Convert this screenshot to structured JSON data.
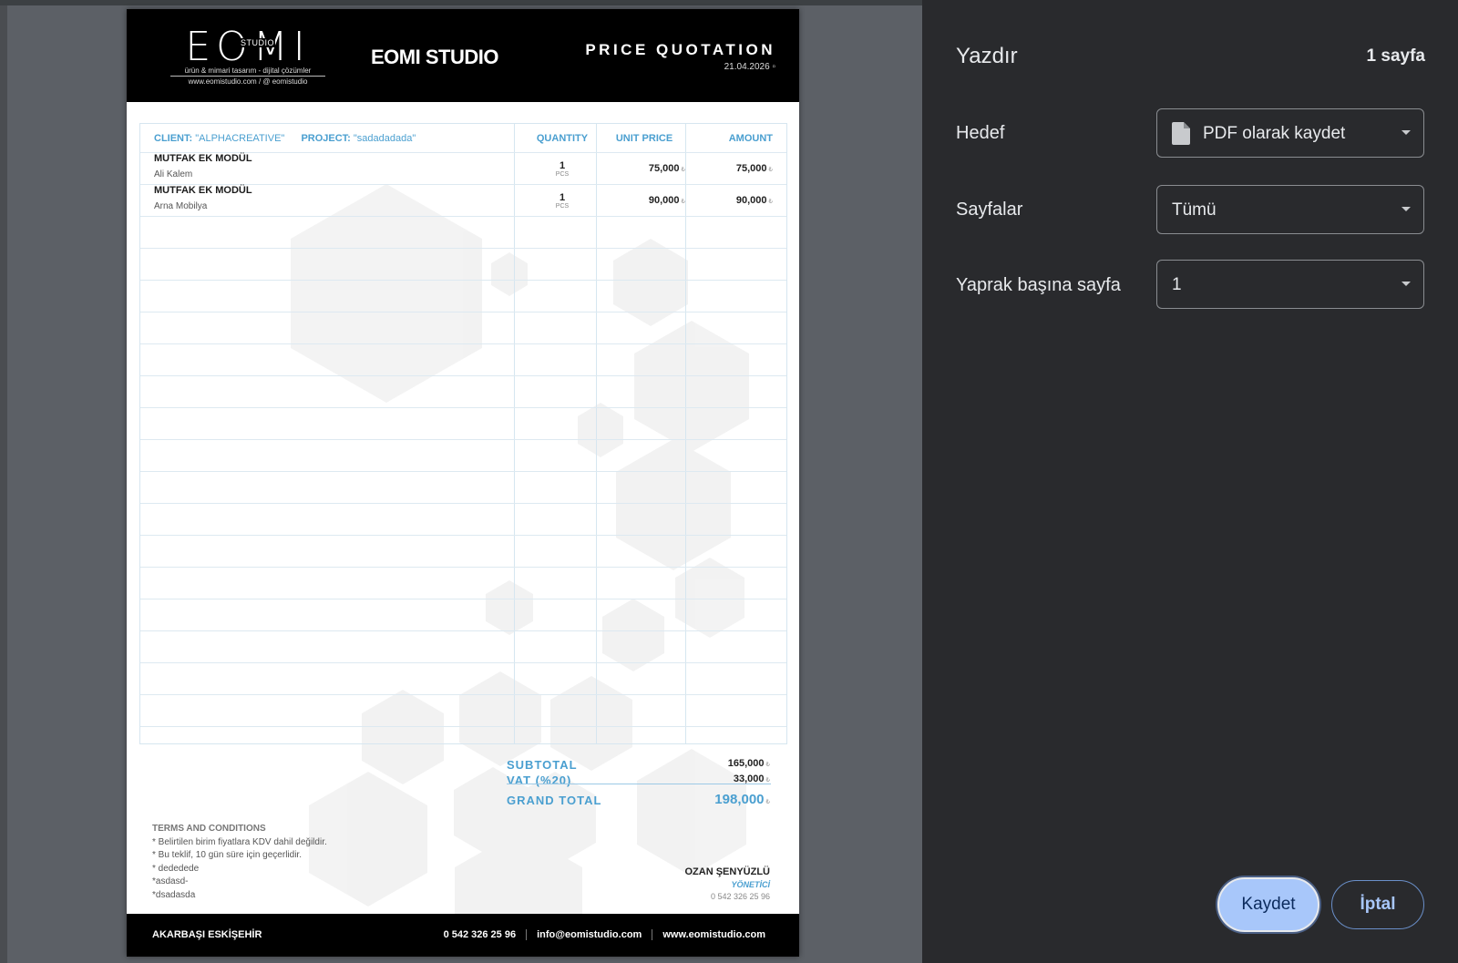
{
  "document": {
    "logo": {
      "main": "EOMI",
      "studio": "STUDIO",
      "tagline": "ürün & mimari tasarım - dijital çözümler",
      "web": "www.eomistudio.com / @ eomistudio"
    },
    "brand": "EOMI STUDIO",
    "title": "PRICE QUOTATION",
    "date": "21.04.2026",
    "client_label": "CLIENT:",
    "client_value": "\"ALPHACREATIVE\"",
    "project_label": "PROJECT:",
    "project_value": "\"sadadadada\"",
    "columns": [
      "QUANTITY",
      "UNIT PRICE",
      "AMOUNT"
    ],
    "items": [
      {
        "name": "MUTFAK EK MODÜL",
        "sub": "Ali Kalem",
        "qty": "1",
        "unit": "PCS",
        "unit_price": "75,000",
        "amount": "75,000"
      },
      {
        "name": "MUTFAK EK MODÜL",
        "sub": "Arna Mobilya",
        "qty": "1",
        "unit": "PCS",
        "unit_price": "90,000",
        "amount": "90,000"
      }
    ],
    "currency": "₺",
    "totals": {
      "subtotal_label": "SUBTOTAL",
      "subtotal": "165,000",
      "vat_label": "VAT (%20)",
      "vat": "33,000",
      "grand_label": "GRAND TOTAL",
      "grand": "198,000"
    },
    "terms": {
      "title": "TERMS AND CONDITIONS",
      "lines": [
        "* Belirtilen birim fiyatlara KDV dahil değildir.",
        "* Bu teklif, 10 gün süre için geçerlidir.",
        "* dededede",
        "*asdasd-",
        "*dsadasda"
      ]
    },
    "signature": {
      "name": "OZAN ŞENYÜZLÜ",
      "role": "YÖNETİCİ",
      "phone": "0 542 326 25 96"
    },
    "footer": {
      "address": "AKARBAŞI ESKİŞEHİR",
      "phone": "0 542 326 25 96",
      "email": "info@eomistudio.com",
      "website": "www.eomistudio.com"
    }
  },
  "print_panel": {
    "title": "Yazdır",
    "page_count": "1 sayfa",
    "destination_label": "Hedef",
    "destination_value": "PDF olarak kaydet",
    "pages_label": "Sayfalar",
    "pages_value": "Tümü",
    "per_sheet_label": "Yaprak başına sayfa",
    "per_sheet_value": "1",
    "save_button": "Kaydet",
    "cancel_button": "İptal"
  },
  "colors": {
    "accent_blue": "#4a9fd0",
    "panel_bg": "#292a2d",
    "save_button_bg": "#a8c7fa"
  }
}
